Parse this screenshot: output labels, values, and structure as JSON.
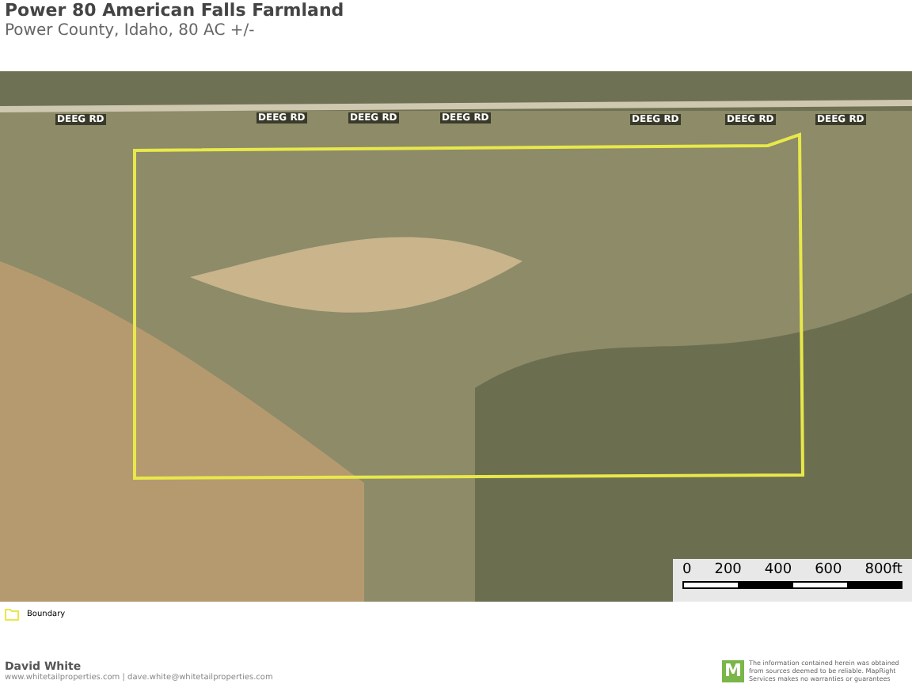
{
  "header": {
    "title": "Power 80 American Falls Farmland",
    "subtitle": "Power County, Idaho, 80 AC +/-"
  },
  "map": {
    "road_labels": [
      "DEEG RD",
      "DEEG RD",
      "DEEG RD",
      "DEEG RD",
      "DEEG RD",
      "DEEG RD",
      "DEEG RD"
    ],
    "scale": {
      "ticks": [
        "0",
        "200",
        "400",
        "600",
        "800ft"
      ]
    }
  },
  "legend": [
    {
      "label": "Boundary",
      "color": "#e8e84a"
    }
  ],
  "footer": {
    "name": "David White",
    "contact": "www.whitetailproperties.com | dave.white@whitetailproperties.com",
    "logo": "M",
    "disclaimer": "The information contained herein was obtained from sources deemed to be reliable. MapRight Services makes no warranties or guarantees"
  }
}
